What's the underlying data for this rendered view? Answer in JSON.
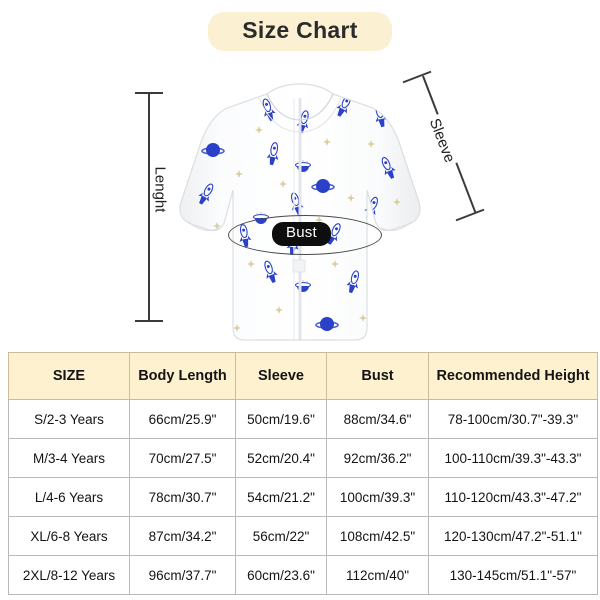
{
  "header": {
    "title": "Size Chart",
    "banner_color": "#fbf0d2"
  },
  "diagram": {
    "length_label": "Lenght",
    "sleeve_label": "Sleeve",
    "bust_label": "Bust",
    "garment_description": "white kids raincoat with blue rocket and planet print",
    "garment_base_color": "#ffffff",
    "print_color": "#2a41c8",
    "star_color": "#d9cfa0"
  },
  "table": {
    "columns": [
      "SIZE",
      "Body Length",
      "Sleeve",
      "Bust",
      "Recommended Height"
    ],
    "header_background": "#fdf1cf",
    "rows": [
      {
        "size": "S/2-3 Years",
        "body_length": "66cm/25.9\"",
        "sleeve": "50cm/19.6\"",
        "bust": "88cm/34.6\"",
        "recommended_height": "78-100cm/30.7\"-39.3\""
      },
      {
        "size": "M/3-4 Years",
        "body_length": "70cm/27.5\"",
        "sleeve": "52cm/20.4\"",
        "bust": "92cm/36.2\"",
        "recommended_height": "100-110cm/39.3\"-43.3\""
      },
      {
        "size": "L/4-6 Years",
        "body_length": "78cm/30.7\"",
        "sleeve": "54cm/21.2\"",
        "bust": "100cm/39.3\"",
        "recommended_height": "110-120cm/43.3\"-47.2\""
      },
      {
        "size": "XL/6-8 Years",
        "body_length": "87cm/34.2\"",
        "sleeve": "56cm/22\"",
        "bust": "108cm/42.5\"",
        "recommended_height": "120-130cm/47.2\"-51.1\""
      },
      {
        "size": "2XL/8-12 Years",
        "body_length": "96cm/37.7\"",
        "sleeve": "60cm/23.6\"",
        "bust": "112cm/40\"",
        "recommended_height": "130-145cm/51.1\"-57\""
      }
    ]
  }
}
